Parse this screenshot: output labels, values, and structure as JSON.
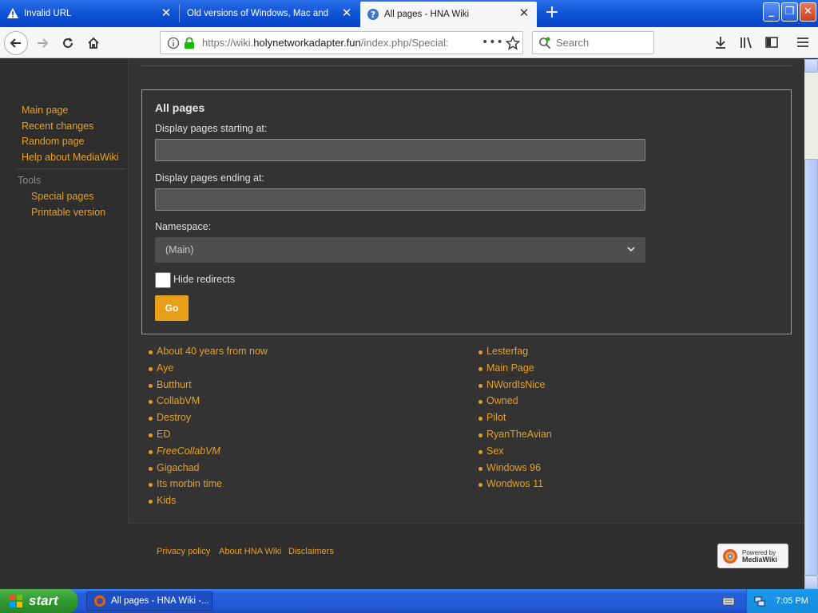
{
  "browser": {
    "tabs": [
      {
        "title": "Invalid URL",
        "icon": "warning-icon",
        "active": false
      },
      {
        "title": "Old versions of Windows, Mac and Linu",
        "icon": "",
        "active": false
      },
      {
        "title": "All pages - HNA Wiki",
        "icon": "help-icon",
        "active": true
      }
    ],
    "url_prefix": "https://wiki.",
    "url_host": "holynetworkadapter.fun",
    "url_path": "/index.php/Special:",
    "search_placeholder": "Search"
  },
  "sidebar": {
    "nav": [
      "Main page",
      "Recent changes",
      "Random page",
      "Help about MediaWiki"
    ],
    "tools_heading": "Tools",
    "tools": [
      "Special pages",
      "Printable version"
    ]
  },
  "form": {
    "legend": "All pages",
    "start_label": "Display pages starting at:",
    "end_label": "Display pages ending at:",
    "namespace_label": "Namespace:",
    "namespace_value": "(Main)",
    "hide_redirects_label": "Hide redirects",
    "go_label": "Go"
  },
  "pages_left": [
    {
      "title": "About 40 years from now",
      "redirect": false
    },
    {
      "title": "Aye",
      "redirect": false
    },
    {
      "title": "Butthurt",
      "redirect": false
    },
    {
      "title": "CollabVM",
      "redirect": false
    },
    {
      "title": "Destroy",
      "redirect": false
    },
    {
      "title": "ED",
      "redirect": false
    },
    {
      "title": "FreeCollabVM",
      "redirect": true
    },
    {
      "title": "Gigachad",
      "redirect": false
    },
    {
      "title": "Its morbin time",
      "redirect": false
    },
    {
      "title": "Kids",
      "redirect": false
    }
  ],
  "pages_right": [
    {
      "title": "Lesterfag",
      "redirect": false
    },
    {
      "title": "Main Page",
      "redirect": false
    },
    {
      "title": "NWordIsNice",
      "redirect": false
    },
    {
      "title": "Owned",
      "redirect": false
    },
    {
      "title": "Pilot",
      "redirect": false
    },
    {
      "title": "RyanTheAvian",
      "redirect": false
    },
    {
      "title": "Sex",
      "redirect": false
    },
    {
      "title": "Windows 96",
      "redirect": false
    },
    {
      "title": "Wondwos 11",
      "redirect": false
    }
  ],
  "footer": {
    "privacy": "Privacy policy",
    "about": "About HNA Wiki",
    "disclaimers": "Disclaimers",
    "powered_line1": "Powered by",
    "powered_line2": "MediaWiki"
  },
  "taskbar": {
    "start_label": "start",
    "task_title": "All pages - HNA Wiki -...",
    "clock": "7:05 PM"
  },
  "colors": {
    "link": "#e8a01b",
    "page_bg": "#2e2e2e",
    "content_bg": "#333333"
  }
}
